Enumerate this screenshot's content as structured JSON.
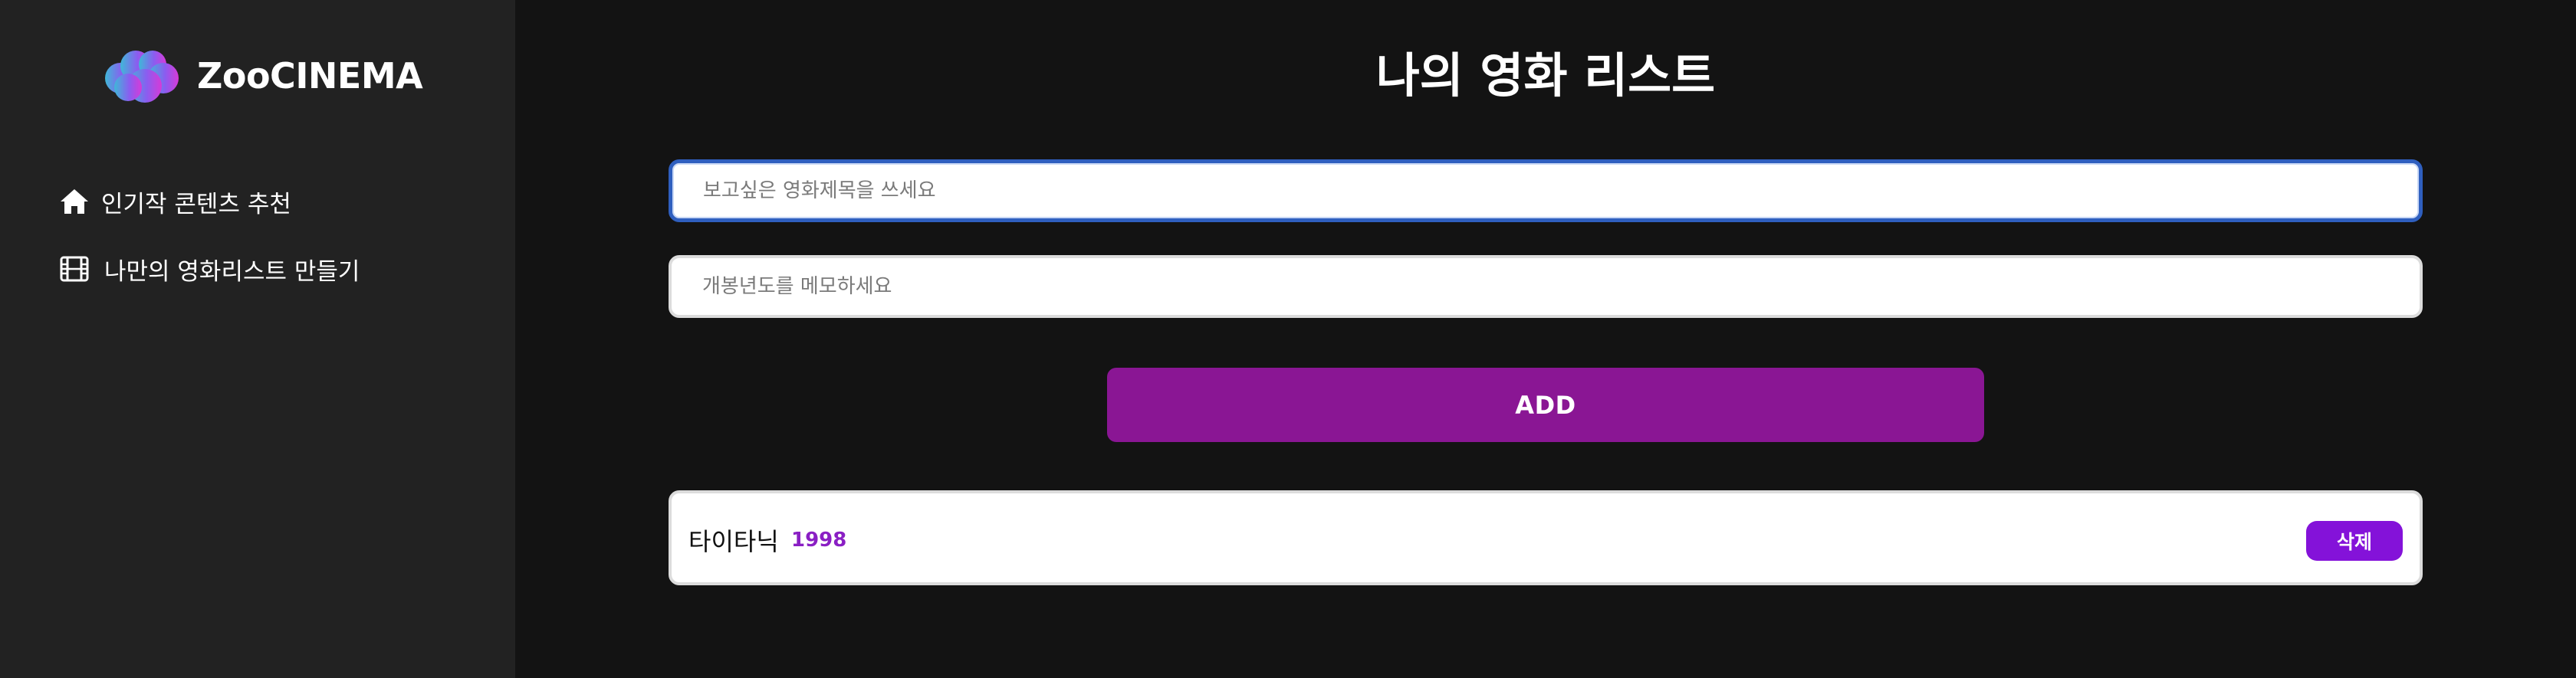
{
  "sidebar": {
    "brand_name": "ZooCINEMA",
    "brand_icon": "cloud-logo-icon",
    "nav": [
      {
        "label": "인기작 콘텐츠 추천",
        "icon": "home-icon"
      },
      {
        "label": "나만의 영화리스트 만들기",
        "icon": "film-icon"
      }
    ]
  },
  "main": {
    "title": "나의 영화 리스트",
    "title_input": {
      "placeholder": "보고싶은 영화제목을 쓰세요",
      "value": ""
    },
    "year_input": {
      "placeholder": "개봉년도를 메모하세요",
      "value": ""
    },
    "add_label": "ADD",
    "movies": [
      {
        "title": "타이타닉",
        "year": "1998",
        "delete_label": "삭제"
      }
    ]
  },
  "colors": {
    "background": "#131313",
    "sidebar": "#222222",
    "accent": "#8a1694",
    "delete": "#8412d9",
    "year_text": "#8a1fc4",
    "focus_border": "#2f5fbf"
  }
}
